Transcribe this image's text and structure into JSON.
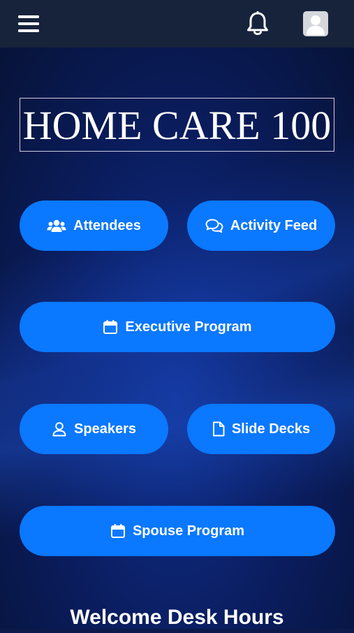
{
  "header": {
    "menu_icon": "hamburger-menu-icon",
    "notification_icon": "bell-icon",
    "profile_icon": "user-avatar-icon"
  },
  "logo": {
    "text": "HOME CARE 100"
  },
  "buttons": {
    "attendees": {
      "label": "Attendees",
      "icon": "users-icon"
    },
    "activity_feed": {
      "label": "Activity Feed",
      "icon": "chat-bubbles-icon"
    },
    "executive_program": {
      "label": "Executive Program",
      "icon": "calendar-icon"
    },
    "speakers": {
      "label": "Speakers",
      "icon": "user-icon"
    },
    "slide_decks": {
      "label": "Slide Decks",
      "icon": "file-icon"
    },
    "spouse_program": {
      "label": "Spouse Program",
      "icon": "calendar-icon"
    }
  },
  "section": {
    "title": "Welcome Desk Hours"
  },
  "colors": {
    "header_bg": "#16233b",
    "button_bg": "#0a78ff",
    "page_bg": "#0b1a4a",
    "text": "#ffffff"
  }
}
